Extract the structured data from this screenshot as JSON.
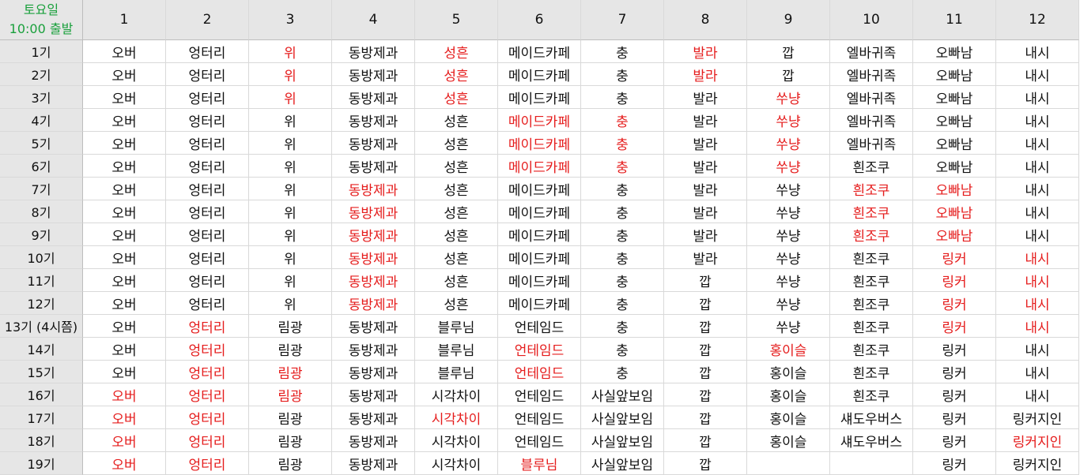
{
  "corner": {
    "line1": "토요일",
    "line2": "10:00 출발"
  },
  "columns": [
    "1",
    "2",
    "3",
    "4",
    "5",
    "6",
    "7",
    "8",
    "9",
    "10",
    "11",
    "12"
  ],
  "colors": {
    "highlight": "#e51c1c",
    "corner_text": "#1aa03c",
    "header_bg": "#e6e6e6"
  },
  "rows": [
    {
      "label": "1기",
      "cells": [
        {
          "text": "오버",
          "hi": false
        },
        {
          "text": "엉터리",
          "hi": false
        },
        {
          "text": "위",
          "hi": true
        },
        {
          "text": "동방제과",
          "hi": false
        },
        {
          "text": "성흔",
          "hi": true
        },
        {
          "text": "메이드카페",
          "hi": false
        },
        {
          "text": "충",
          "hi": false
        },
        {
          "text": "발라",
          "hi": true
        },
        {
          "text": "깝",
          "hi": false
        },
        {
          "text": "엘바귀족",
          "hi": false
        },
        {
          "text": "오빠남",
          "hi": false
        },
        {
          "text": "내시",
          "hi": false
        }
      ]
    },
    {
      "label": "2기",
      "cells": [
        {
          "text": "오버",
          "hi": false
        },
        {
          "text": "엉터리",
          "hi": false
        },
        {
          "text": "위",
          "hi": true
        },
        {
          "text": "동방제과",
          "hi": false
        },
        {
          "text": "성흔",
          "hi": true
        },
        {
          "text": "메이드카페",
          "hi": false
        },
        {
          "text": "충",
          "hi": false
        },
        {
          "text": "발라",
          "hi": true
        },
        {
          "text": "깝",
          "hi": false
        },
        {
          "text": "엘바귀족",
          "hi": false
        },
        {
          "text": "오빠남",
          "hi": false
        },
        {
          "text": "내시",
          "hi": false
        }
      ]
    },
    {
      "label": "3기",
      "cells": [
        {
          "text": "오버",
          "hi": false
        },
        {
          "text": "엉터리",
          "hi": false
        },
        {
          "text": "위",
          "hi": true
        },
        {
          "text": "동방제과",
          "hi": false
        },
        {
          "text": "성흔",
          "hi": true
        },
        {
          "text": "메이드카페",
          "hi": false
        },
        {
          "text": "충",
          "hi": false
        },
        {
          "text": "발라",
          "hi": false
        },
        {
          "text": "쑤냥",
          "hi": true
        },
        {
          "text": "엘바귀족",
          "hi": false
        },
        {
          "text": "오빠남",
          "hi": false
        },
        {
          "text": "내시",
          "hi": false
        }
      ]
    },
    {
      "label": "4기",
      "cells": [
        {
          "text": "오버",
          "hi": false
        },
        {
          "text": "엉터리",
          "hi": false
        },
        {
          "text": "위",
          "hi": false
        },
        {
          "text": "동방제과",
          "hi": false
        },
        {
          "text": "성흔",
          "hi": false
        },
        {
          "text": "메이드카페",
          "hi": true
        },
        {
          "text": "충",
          "hi": true
        },
        {
          "text": "발라",
          "hi": false
        },
        {
          "text": "쑤냥",
          "hi": true
        },
        {
          "text": "엘바귀족",
          "hi": false
        },
        {
          "text": "오빠남",
          "hi": false
        },
        {
          "text": "내시",
          "hi": false
        }
      ]
    },
    {
      "label": "5기",
      "cells": [
        {
          "text": "오버",
          "hi": false
        },
        {
          "text": "엉터리",
          "hi": false
        },
        {
          "text": "위",
          "hi": false
        },
        {
          "text": "동방제과",
          "hi": false
        },
        {
          "text": "성흔",
          "hi": false
        },
        {
          "text": "메이드카페",
          "hi": true
        },
        {
          "text": "충",
          "hi": true
        },
        {
          "text": "발라",
          "hi": false
        },
        {
          "text": "쑤냥",
          "hi": true
        },
        {
          "text": "엘바귀족",
          "hi": false
        },
        {
          "text": "오빠남",
          "hi": false
        },
        {
          "text": "내시",
          "hi": false
        }
      ]
    },
    {
      "label": "6기",
      "cells": [
        {
          "text": "오버",
          "hi": false
        },
        {
          "text": "엉터리",
          "hi": false
        },
        {
          "text": "위",
          "hi": false
        },
        {
          "text": "동방제과",
          "hi": false
        },
        {
          "text": "성흔",
          "hi": false
        },
        {
          "text": "메이드카페",
          "hi": true
        },
        {
          "text": "충",
          "hi": true
        },
        {
          "text": "발라",
          "hi": false
        },
        {
          "text": "쑤냥",
          "hi": true
        },
        {
          "text": "흰조쿠",
          "hi": false
        },
        {
          "text": "오빠남",
          "hi": false
        },
        {
          "text": "내시",
          "hi": false
        }
      ]
    },
    {
      "label": "7기",
      "cells": [
        {
          "text": "오버",
          "hi": false
        },
        {
          "text": "엉터리",
          "hi": false
        },
        {
          "text": "위",
          "hi": false
        },
        {
          "text": "동방제과",
          "hi": true
        },
        {
          "text": "성흔",
          "hi": false
        },
        {
          "text": "메이드카페",
          "hi": false
        },
        {
          "text": "충",
          "hi": false
        },
        {
          "text": "발라",
          "hi": false
        },
        {
          "text": "쑤냥",
          "hi": false
        },
        {
          "text": "흰조쿠",
          "hi": true
        },
        {
          "text": "오빠남",
          "hi": true
        },
        {
          "text": "내시",
          "hi": false
        }
      ]
    },
    {
      "label": "8기",
      "cells": [
        {
          "text": "오버",
          "hi": false
        },
        {
          "text": "엉터리",
          "hi": false
        },
        {
          "text": "위",
          "hi": false
        },
        {
          "text": "동방제과",
          "hi": true
        },
        {
          "text": "성흔",
          "hi": false
        },
        {
          "text": "메이드카페",
          "hi": false
        },
        {
          "text": "충",
          "hi": false
        },
        {
          "text": "발라",
          "hi": false
        },
        {
          "text": "쑤냥",
          "hi": false
        },
        {
          "text": "흰조쿠",
          "hi": true
        },
        {
          "text": "오빠남",
          "hi": true
        },
        {
          "text": "내시",
          "hi": false
        }
      ]
    },
    {
      "label": "9기",
      "cells": [
        {
          "text": "오버",
          "hi": false
        },
        {
          "text": "엉터리",
          "hi": false
        },
        {
          "text": "위",
          "hi": false
        },
        {
          "text": "동방제과",
          "hi": true
        },
        {
          "text": "성흔",
          "hi": false
        },
        {
          "text": "메이드카페",
          "hi": false
        },
        {
          "text": "충",
          "hi": false
        },
        {
          "text": "발라",
          "hi": false
        },
        {
          "text": "쑤냥",
          "hi": false
        },
        {
          "text": "흰조쿠",
          "hi": true
        },
        {
          "text": "오빠남",
          "hi": true
        },
        {
          "text": "내시",
          "hi": false
        }
      ]
    },
    {
      "label": "10기",
      "cells": [
        {
          "text": "오버",
          "hi": false
        },
        {
          "text": "엉터리",
          "hi": false
        },
        {
          "text": "위",
          "hi": false
        },
        {
          "text": "동방제과",
          "hi": true
        },
        {
          "text": "성흔",
          "hi": false
        },
        {
          "text": "메이드카페",
          "hi": false
        },
        {
          "text": "충",
          "hi": false
        },
        {
          "text": "발라",
          "hi": false
        },
        {
          "text": "쑤냥",
          "hi": false
        },
        {
          "text": "흰조쿠",
          "hi": false
        },
        {
          "text": "링커",
          "hi": true
        },
        {
          "text": "내시",
          "hi": true
        }
      ]
    },
    {
      "label": "11기",
      "cells": [
        {
          "text": "오버",
          "hi": false
        },
        {
          "text": "엉터리",
          "hi": false
        },
        {
          "text": "위",
          "hi": false
        },
        {
          "text": "동방제과",
          "hi": true
        },
        {
          "text": "성흔",
          "hi": false
        },
        {
          "text": "메이드카페",
          "hi": false
        },
        {
          "text": "충",
          "hi": false
        },
        {
          "text": "깝",
          "hi": false
        },
        {
          "text": "쑤냥",
          "hi": false
        },
        {
          "text": "흰조쿠",
          "hi": false
        },
        {
          "text": "링커",
          "hi": true
        },
        {
          "text": "내시",
          "hi": true
        }
      ]
    },
    {
      "label": "12기",
      "cells": [
        {
          "text": "오버",
          "hi": false
        },
        {
          "text": "엉터리",
          "hi": false
        },
        {
          "text": "위",
          "hi": false
        },
        {
          "text": "동방제과",
          "hi": true
        },
        {
          "text": "성흔",
          "hi": false
        },
        {
          "text": "메이드카페",
          "hi": false
        },
        {
          "text": "충",
          "hi": false
        },
        {
          "text": "깝",
          "hi": false
        },
        {
          "text": "쑤냥",
          "hi": false
        },
        {
          "text": "흰조쿠",
          "hi": false
        },
        {
          "text": "링커",
          "hi": true
        },
        {
          "text": "내시",
          "hi": true
        }
      ]
    },
    {
      "label": "13기 (4시쯤)",
      "cells": [
        {
          "text": "오버",
          "hi": false
        },
        {
          "text": "엉터리",
          "hi": true
        },
        {
          "text": "림광",
          "hi": false
        },
        {
          "text": "동방제과",
          "hi": false
        },
        {
          "text": "블루님",
          "hi": false
        },
        {
          "text": "언테임드",
          "hi": false
        },
        {
          "text": "충",
          "hi": false
        },
        {
          "text": "깝",
          "hi": false
        },
        {
          "text": "쑤냥",
          "hi": false
        },
        {
          "text": "흰조쿠",
          "hi": false
        },
        {
          "text": "링커",
          "hi": true
        },
        {
          "text": "내시",
          "hi": true
        }
      ]
    },
    {
      "label": "14기",
      "cells": [
        {
          "text": "오버",
          "hi": false
        },
        {
          "text": "엉터리",
          "hi": true
        },
        {
          "text": "림광",
          "hi": false
        },
        {
          "text": "동방제과",
          "hi": false
        },
        {
          "text": "블루님",
          "hi": false
        },
        {
          "text": "언테임드",
          "hi": true
        },
        {
          "text": "충",
          "hi": false
        },
        {
          "text": "깝",
          "hi": false
        },
        {
          "text": "홍이슬",
          "hi": true
        },
        {
          "text": "흰조쿠",
          "hi": false
        },
        {
          "text": "링커",
          "hi": false
        },
        {
          "text": "내시",
          "hi": false
        }
      ]
    },
    {
      "label": "15기",
      "cells": [
        {
          "text": "오버",
          "hi": false
        },
        {
          "text": "엉터리",
          "hi": true
        },
        {
          "text": "림광",
          "hi": true
        },
        {
          "text": "동방제과",
          "hi": false
        },
        {
          "text": "블루님",
          "hi": false
        },
        {
          "text": "언테임드",
          "hi": true
        },
        {
          "text": "충",
          "hi": false
        },
        {
          "text": "깝",
          "hi": false
        },
        {
          "text": "홍이슬",
          "hi": false
        },
        {
          "text": "흰조쿠",
          "hi": false
        },
        {
          "text": "링커",
          "hi": false
        },
        {
          "text": "내시",
          "hi": false
        }
      ]
    },
    {
      "label": "16기",
      "cells": [
        {
          "text": "오버",
          "hi": true
        },
        {
          "text": "엉터리",
          "hi": true
        },
        {
          "text": "림광",
          "hi": true
        },
        {
          "text": "동방제과",
          "hi": false
        },
        {
          "text": "시각차이",
          "hi": false
        },
        {
          "text": "언테임드",
          "hi": false
        },
        {
          "text": "사실앞보임",
          "hi": false
        },
        {
          "text": "깝",
          "hi": false
        },
        {
          "text": "홍이슬",
          "hi": false
        },
        {
          "text": "흰조쿠",
          "hi": false
        },
        {
          "text": "링커",
          "hi": false
        },
        {
          "text": "내시",
          "hi": false
        }
      ]
    },
    {
      "label": "17기",
      "cells": [
        {
          "text": "오버",
          "hi": true
        },
        {
          "text": "엉터리",
          "hi": true
        },
        {
          "text": "림광",
          "hi": false
        },
        {
          "text": "동방제과",
          "hi": false
        },
        {
          "text": "시각차이",
          "hi": true
        },
        {
          "text": "언테임드",
          "hi": false
        },
        {
          "text": "사실앞보임",
          "hi": false
        },
        {
          "text": "깝",
          "hi": false
        },
        {
          "text": "홍이슬",
          "hi": false
        },
        {
          "text": "섀도우버스",
          "hi": false
        },
        {
          "text": "링커",
          "hi": false
        },
        {
          "text": "링커지인",
          "hi": false
        }
      ]
    },
    {
      "label": "18기",
      "cells": [
        {
          "text": "오버",
          "hi": true
        },
        {
          "text": "엉터리",
          "hi": true
        },
        {
          "text": "림광",
          "hi": false
        },
        {
          "text": "동방제과",
          "hi": false
        },
        {
          "text": "시각차이",
          "hi": false
        },
        {
          "text": "언테임드",
          "hi": false
        },
        {
          "text": "사실앞보임",
          "hi": false
        },
        {
          "text": "깝",
          "hi": false
        },
        {
          "text": "홍이슬",
          "hi": false
        },
        {
          "text": "섀도우버스",
          "hi": false
        },
        {
          "text": "링커",
          "hi": false
        },
        {
          "text": "링커지인",
          "hi": true
        }
      ]
    },
    {
      "label": "19기",
      "cells": [
        {
          "text": "오버",
          "hi": true
        },
        {
          "text": "엉터리",
          "hi": true
        },
        {
          "text": "림광",
          "hi": false
        },
        {
          "text": "동방제과",
          "hi": false
        },
        {
          "text": "시각차이",
          "hi": false
        },
        {
          "text": "블루님",
          "hi": true
        },
        {
          "text": "사실앞보임",
          "hi": false
        },
        {
          "text": "깝",
          "hi": false
        },
        {
          "text": "",
          "hi": false
        },
        {
          "text": "",
          "hi": false
        },
        {
          "text": "링커",
          "hi": false
        },
        {
          "text": "링커지인",
          "hi": false
        }
      ]
    }
  ]
}
